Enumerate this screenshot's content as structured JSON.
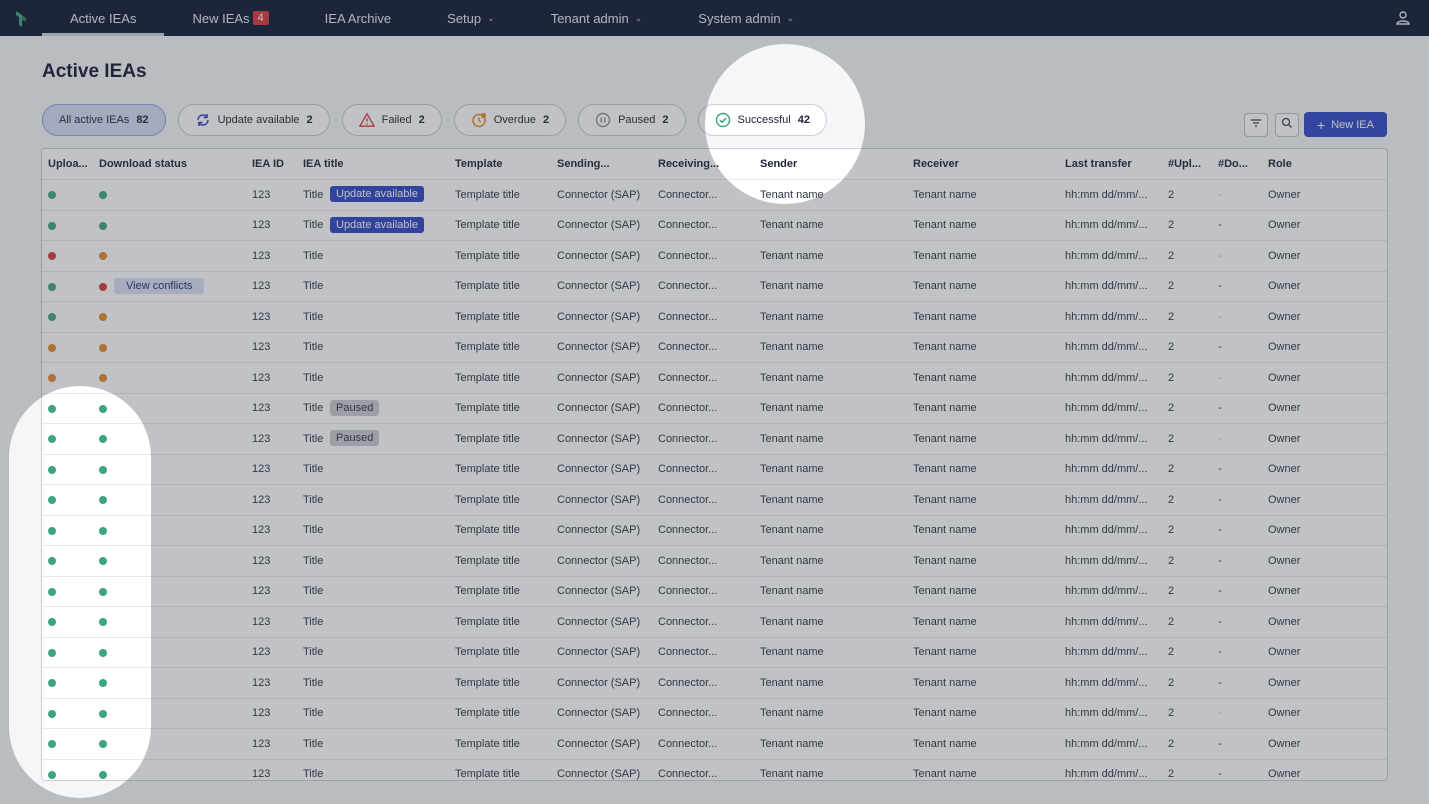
{
  "nav": {
    "items": [
      {
        "label": "Active IEAs",
        "active": true,
        "dropdown": false
      },
      {
        "label": "New IEAs",
        "badge": "4",
        "dropdown": false
      },
      {
        "label": "IEA Archive",
        "dropdown": false
      },
      {
        "label": "Setup",
        "dropdown": true
      },
      {
        "label": "Tenant admin",
        "dropdown": true
      },
      {
        "label": "System admin",
        "dropdown": true
      }
    ],
    "user_icon": "user-icon"
  },
  "page": {
    "title": "Active IEAs"
  },
  "filters": [
    {
      "label": "All active IEAs",
      "count": "82",
      "selected": true,
      "icon": ""
    },
    {
      "label": "Update available",
      "count": "2",
      "icon": "refresh-icon"
    },
    {
      "label": "Failed",
      "count": "2",
      "icon": "warning-icon"
    },
    {
      "label": "Overdue",
      "count": "2",
      "icon": "overdue-clock-icon"
    },
    {
      "label": "Paused",
      "count": "2",
      "icon": "pause-icon"
    },
    {
      "label": "Successful",
      "count": "42",
      "icon": "check-circle-icon",
      "highlighted": true
    }
  ],
  "toolbar": {
    "new_label": "New IEA",
    "filter_icon": "filter-icon",
    "search_icon": "search-icon"
  },
  "colors": {
    "green": "#3ea37f",
    "orange": "#e58a2b",
    "red": "#d63a3a",
    "accent": "#3148c7",
    "nav": "#0e1933"
  },
  "table": {
    "columns": [
      "Uploa...",
      "Download status",
      "IEA ID",
      "IEA title",
      "Template",
      "Sending...",
      "Receiving...",
      "Sender",
      "Receiver",
      "Last transfer",
      "#Upl...",
      "#Do...",
      "Role"
    ],
    "rows": [
      {
        "up": "green",
        "down": "green",
        "id": "123",
        "title": "Title",
        "tag": "Update available",
        "tagType": "update",
        "template": "Template title",
        "sending": "Connector (SAP)",
        "receiving": "Connector...",
        "sender": "Tenant name",
        "receiver": "Tenant name",
        "last": "hh:mm dd/mm/...",
        "upl": "2",
        "dl": "-",
        "dlMuted": true,
        "role": "Owner"
      },
      {
        "up": "green",
        "down": "green",
        "id": "123",
        "title": "Title",
        "tag": "Update available",
        "tagType": "update",
        "template": "Template title",
        "sending": "Connector (SAP)",
        "receiving": "Connector...",
        "sender": "Tenant name",
        "receiver": "Tenant name",
        "last": "hh:mm dd/mm/...",
        "upl": "2",
        "dl": "-",
        "dlMuted": false,
        "role": "Owner"
      },
      {
        "up": "red",
        "down": "orange",
        "id": "123",
        "title": "Title",
        "tag": "",
        "template": "Template title",
        "sending": "Connector (SAP)",
        "receiving": "Connector...",
        "sender": "Tenant name",
        "receiver": "Tenant name",
        "last": "hh:mm dd/mm/...",
        "upl": "2",
        "dl": "-",
        "dlMuted": true,
        "role": "Owner"
      },
      {
        "up": "green",
        "down": "red",
        "conflict": "View conflicts",
        "id": "123",
        "title": "Title",
        "tag": "",
        "template": "Template title",
        "sending": "Connector (SAP)",
        "receiving": "Connector...",
        "sender": "Tenant name",
        "receiver": "Tenant name",
        "last": "hh:mm dd/mm/...",
        "upl": "2",
        "dl": "-",
        "dlMuted": false,
        "role": "Owner"
      },
      {
        "up": "green",
        "down": "orange",
        "id": "123",
        "title": "Title",
        "tag": "",
        "template": "Template title",
        "sending": "Connector (SAP)",
        "receiving": "Connector...",
        "sender": "Tenant name",
        "receiver": "Tenant name",
        "last": "hh:mm dd/mm/...",
        "upl": "2",
        "dl": "-",
        "dlMuted": true,
        "role": "Owner"
      },
      {
        "up": "orange",
        "down": "orange",
        "id": "123",
        "title": "Title",
        "tag": "",
        "template": "Template title",
        "sending": "Connector (SAP)",
        "receiving": "Connector...",
        "sender": "Tenant name",
        "receiver": "Tenant name",
        "last": "hh:mm dd/mm/...",
        "upl": "2",
        "dl": "-",
        "dlMuted": false,
        "role": "Owner"
      },
      {
        "up": "orange",
        "down": "orange",
        "id": "123",
        "title": "Title",
        "tag": "",
        "template": "Template title",
        "sending": "Connector (SAP)",
        "receiving": "Connector...",
        "sender": "Tenant name",
        "receiver": "Tenant name",
        "last": "hh:mm dd/mm/...",
        "upl": "2",
        "dl": "-",
        "dlMuted": true,
        "role": "Owner"
      },
      {
        "up": "green",
        "down": "green",
        "id": "123",
        "title": "Title",
        "tag": "Paused",
        "tagType": "paused",
        "template": "Template title",
        "sending": "Connector (SAP)",
        "receiving": "Connector...",
        "sender": "Tenant name",
        "receiver": "Tenant name",
        "last": "hh:mm dd/mm/...",
        "upl": "2",
        "dl": "-",
        "dlMuted": false,
        "role": "Owner"
      },
      {
        "up": "green",
        "down": "green",
        "id": "123",
        "title": "Title",
        "tag": "Paused",
        "tagType": "paused",
        "template": "Template title",
        "sending": "Connector (SAP)",
        "receiving": "Connector...",
        "sender": "Tenant name",
        "receiver": "Tenant name",
        "last": "hh:mm dd/mm/...",
        "upl": "2",
        "dl": "-",
        "dlMuted": true,
        "role": "Owner"
      },
      {
        "up": "green",
        "down": "green",
        "id": "123",
        "title": "Title",
        "tag": "",
        "template": "Template title",
        "sending": "Connector (SAP)",
        "receiving": "Connector...",
        "sender": "Tenant name",
        "receiver": "Tenant name",
        "last": "hh:mm dd/mm/...",
        "upl": "2",
        "dl": "-",
        "dlMuted": false,
        "role": "Owner"
      },
      {
        "up": "green",
        "down": "green",
        "id": "123",
        "title": "Title",
        "tag": "",
        "template": "Template title",
        "sending": "Connector (SAP)",
        "receiving": "Connector...",
        "sender": "Tenant name",
        "receiver": "Tenant name",
        "last": "hh:mm dd/mm/...",
        "upl": "2",
        "dl": "-",
        "dlMuted": false,
        "role": "Owner"
      },
      {
        "up": "green",
        "down": "green",
        "id": "123",
        "title": "Title",
        "tag": "",
        "template": "Template title",
        "sending": "Connector (SAP)",
        "receiving": "Connector...",
        "sender": "Tenant name",
        "receiver": "Tenant name",
        "last": "hh:mm dd/mm/...",
        "upl": "2",
        "dl": "-",
        "dlMuted": false,
        "role": "Owner"
      },
      {
        "up": "green",
        "down": "green",
        "id": "123",
        "title": "Title",
        "tag": "",
        "template": "Template title",
        "sending": "Connector (SAP)",
        "receiving": "Connector...",
        "sender": "Tenant name",
        "receiver": "Tenant name",
        "last": "hh:mm dd/mm/...",
        "upl": "2",
        "dl": "-",
        "dlMuted": false,
        "role": "Owner"
      },
      {
        "up": "green",
        "down": "green",
        "id": "123",
        "title": "Title",
        "tag": "",
        "template": "Template title",
        "sending": "Connector (SAP)",
        "receiving": "Connector...",
        "sender": "Tenant name",
        "receiver": "Tenant name",
        "last": "hh:mm dd/mm/...",
        "upl": "2",
        "dl": "-",
        "dlMuted": false,
        "role": "Owner"
      },
      {
        "up": "green",
        "down": "green",
        "id": "123",
        "title": "Title",
        "tag": "",
        "template": "Template title",
        "sending": "Connector (SAP)",
        "receiving": "Connector...",
        "sender": "Tenant name",
        "receiver": "Tenant name",
        "last": "hh:mm dd/mm/...",
        "upl": "2",
        "dl": "-",
        "dlMuted": false,
        "role": "Owner"
      },
      {
        "up": "green",
        "down": "green",
        "id": "123",
        "title": "Title",
        "tag": "",
        "template": "Template title",
        "sending": "Connector (SAP)",
        "receiving": "Connector...",
        "sender": "Tenant name",
        "receiver": "Tenant name",
        "last": "hh:mm dd/mm/...",
        "upl": "2",
        "dl": "-",
        "dlMuted": false,
        "role": "Owner"
      },
      {
        "up": "green",
        "down": "green",
        "id": "123",
        "title": "Title",
        "tag": "",
        "template": "Template title",
        "sending": "Connector (SAP)",
        "receiving": "Connector...",
        "sender": "Tenant name",
        "receiver": "Tenant name",
        "last": "hh:mm dd/mm/...",
        "upl": "2",
        "dl": "-",
        "dlMuted": false,
        "role": "Owner"
      },
      {
        "up": "green",
        "down": "green",
        "id": "123",
        "title": "Title",
        "tag": "",
        "template": "Template title",
        "sending": "Connector (SAP)",
        "receiving": "Connector...",
        "sender": "Tenant name",
        "receiver": "Tenant name",
        "last": "hh:mm dd/mm/...",
        "upl": "2",
        "dl": "-",
        "dlMuted": true,
        "role": "Owner"
      },
      {
        "up": "green",
        "down": "green",
        "id": "123",
        "title": "Title",
        "tag": "",
        "template": "Template title",
        "sending": "Connector (SAP)",
        "receiving": "Connector...",
        "sender": "Tenant name",
        "receiver": "Tenant name",
        "last": "hh:mm dd/mm/...",
        "upl": "2",
        "dl": "-",
        "dlMuted": false,
        "role": "Owner"
      },
      {
        "up": "green",
        "down": "green",
        "id": "123",
        "title": "Title",
        "tag": "",
        "template": "Template title",
        "sending": "Connector (SAP)",
        "receiving": "Connector...",
        "sender": "Tenant name",
        "receiver": "Tenant name",
        "last": "hh:mm dd/mm/...",
        "upl": "2",
        "dl": "-",
        "dlMuted": false,
        "role": "Owner"
      }
    ]
  }
}
